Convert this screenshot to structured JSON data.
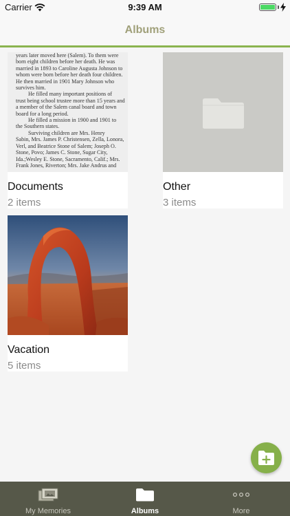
{
  "status_bar": {
    "carrier": "Carrier",
    "time": "9:39 AM",
    "icons": [
      "wifi-icon",
      "battery-icon",
      "charging-bolt-icon"
    ]
  },
  "nav": {
    "title": "Albums"
  },
  "albums": [
    {
      "title": "Documents",
      "count": "2 items",
      "thumbnail_text": [
        "years later moved here (Salem). To them were",
        "born eight children before her death. He was",
        "married in 1893 to Caroline Augusta Johnson to",
        "whom were born before her death four children.",
        "He then married in 1901 Mary Johnson who",
        "survives him.",
        "He filled many important positions of",
        "trust being school trustee more than 15 years and",
        "a member of the Salem canal board and town",
        "board for a long period.",
        "He filled a mission in 1900 and 1901 to",
        "the Southern states.",
        "Surviving children are Mrs. Henry",
        "Sabin, Mrs. James P. Christensen, Zella, Lonora,",
        "Verl, and Beatrice Stone of Salem; Joseph O.",
        "Stone, Povo; James C. Stone, Sugar City,",
        "Ida.;Wesley E. Stone, Sacramento, Calif.; Mrs.",
        "Frank Jones, Riverton; Mrs. Jake Andrus and"
      ]
    },
    {
      "title": "Other",
      "count": "3 items",
      "thumbnail_icon": "folder-icon"
    },
    {
      "title": "Vacation",
      "count": "5 items",
      "thumbnail_icon": "arch-photo"
    }
  ],
  "fab": {
    "icon": "add-folder-icon",
    "color": "#86b04a"
  },
  "tabs": [
    {
      "label": "My Memories",
      "icon": "memories-icon",
      "active": false
    },
    {
      "label": "Albums",
      "icon": "folder-icon",
      "active": true
    },
    {
      "label": "More",
      "icon": "more-dots-icon",
      "active": false
    }
  ],
  "colors": {
    "accent_line": "#8bb44f",
    "nav_title": "#a0a07a",
    "tab_bar": "#565849"
  }
}
